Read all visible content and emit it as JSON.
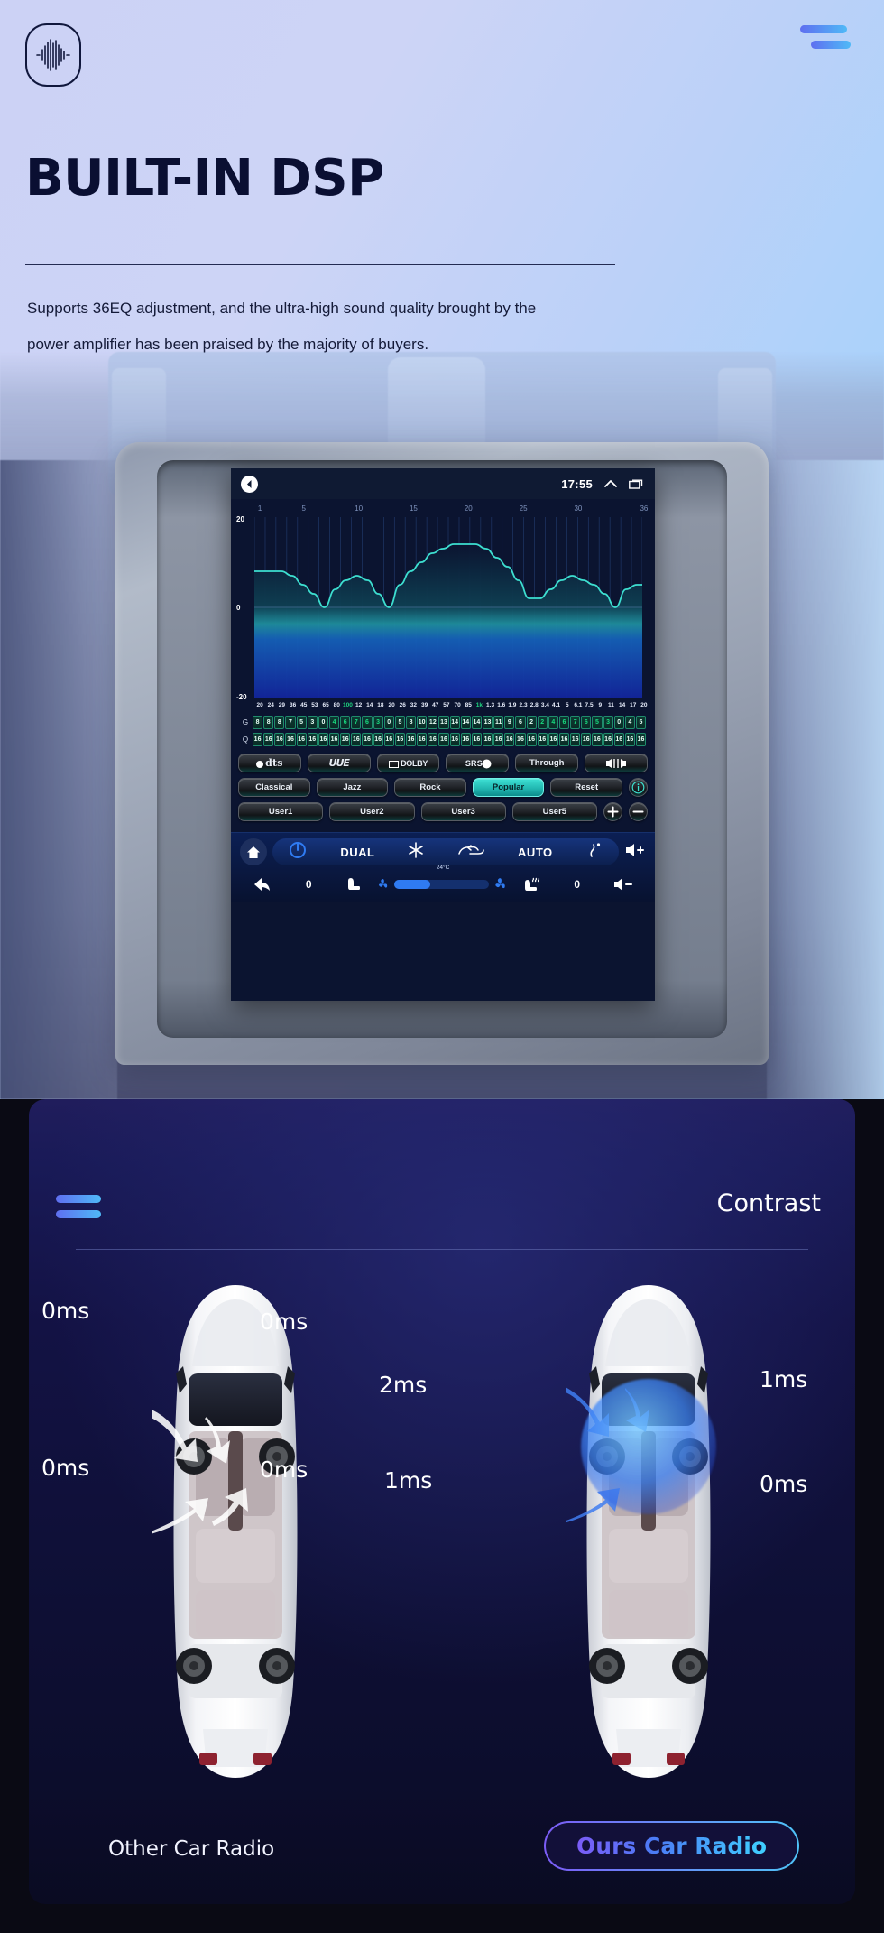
{
  "hero": {
    "logo_icon": "audio-waveform-icon",
    "menu_icon": "hamburger-icon",
    "title": "BUILT-IN DSP",
    "subtitle": "Supports 36EQ adjustment, and the ultra-high sound quality brought by the power amplifier has been praised by the majority of buyers."
  },
  "head_unit": {
    "status_bar": {
      "back_icon": "back-arrow-icon",
      "time": "17:55",
      "chevron_icon": "chevron-up-icon",
      "recents_icon": "recents-icon"
    },
    "eq": {
      "x_ticks": [
        "1",
        "5",
        "10",
        "15",
        "20",
        "25",
        "30",
        "36"
      ],
      "y_labels": {
        "top": "20",
        "mid": "0",
        "bottom": "-20"
      },
      "gain_row_label": "G",
      "q_row_label": "Q",
      "frequencies": [
        "20",
        "24",
        "29",
        "36",
        "45",
        "53",
        "65",
        "80",
        "100",
        "12",
        "14",
        "18",
        "20",
        "26",
        "32",
        "39",
        "47",
        "57",
        "70",
        "85",
        "1k",
        "1.3",
        "1.6",
        "1.9",
        "2.3",
        "2.8",
        "3.4",
        "4.1",
        "5",
        "6.1",
        "7.5",
        "9",
        "11",
        "14",
        "17",
        "20"
      ],
      "gains": [
        8,
        8,
        8,
        7,
        5,
        3,
        0,
        4,
        6,
        7,
        6,
        3,
        0,
        5,
        8,
        10,
        12,
        13,
        14,
        14,
        14,
        13,
        11,
        9,
        6,
        2,
        2,
        4,
        6,
        7,
        6,
        5,
        3,
        0,
        4,
        5
      ],
      "q_values": [
        16,
        16,
        16,
        16,
        16,
        16,
        16,
        16,
        16,
        16,
        16,
        16,
        16,
        16,
        16,
        16,
        16,
        16,
        16,
        16,
        16,
        16,
        16,
        16,
        16,
        16,
        16,
        16,
        16,
        16,
        16,
        16,
        16,
        16,
        16,
        16
      ],
      "highlight_freq_indices": [
        8,
        20
      ],
      "highlight_gain_indices": [
        7,
        8,
        9,
        10,
        11,
        26,
        27,
        28,
        29,
        30,
        31,
        32
      ]
    },
    "presets": {
      "row1": [
        {
          "label": "dts",
          "kind": "logo-dts",
          "active": false
        },
        {
          "label": "UUE",
          "kind": "logo-uue",
          "active": false
        },
        {
          "label": "DOLBY",
          "kind": "logo-dolby",
          "active": false
        },
        {
          "label": "SRS",
          "kind": "logo-srs",
          "active": false
        },
        {
          "label": "Through",
          "kind": "text",
          "active": false
        },
        {
          "label": "",
          "kind": "balance-icon",
          "active": false
        }
      ],
      "row2": [
        {
          "label": "Classical",
          "kind": "text",
          "active": false
        },
        {
          "label": "Jazz",
          "kind": "text",
          "active": false
        },
        {
          "label": "Rock",
          "kind": "text",
          "active": false
        },
        {
          "label": "Popular",
          "kind": "text",
          "active": true
        },
        {
          "label": "Reset",
          "kind": "text",
          "active": false
        },
        {
          "label": "i",
          "kind": "info-icon",
          "active": false
        }
      ],
      "row3": [
        {
          "label": "User1",
          "kind": "text",
          "active": false
        },
        {
          "label": "User2",
          "kind": "text",
          "active": false
        },
        {
          "label": "User3",
          "kind": "text",
          "active": false
        },
        {
          "label": "User5",
          "kind": "text",
          "active": false
        },
        {
          "label": "+",
          "kind": "plus-icon",
          "active": false
        },
        {
          "label": "−",
          "kind": "minus-icon",
          "active": false
        }
      ]
    },
    "climate": {
      "home_icon": "home-icon",
      "power_icon": "power-icon",
      "dual_label": "DUAL",
      "ac_icon": "snowflake-icon",
      "recirculate_icon": "air-recirculation-icon",
      "auto_label": "AUTO",
      "defrost_icon": "defrost-icon",
      "volume_up_icon": "volume-up-icon",
      "temperature": "24°C",
      "back_icon": "back-arrow-icon",
      "left_value": "0",
      "seat_icon": "seat-airflow-icon",
      "fan_low_icon": "fan-low-icon",
      "fan_high_icon": "fan-high-icon",
      "fan_level_percent": 38,
      "seat_heat_icon": "seat-heat-icon",
      "right_value": "0",
      "volume_down_icon": "volume-down-icon"
    }
  },
  "contrast": {
    "menu_icon": "hamburger-icon",
    "title": "Contrast",
    "left_car": {
      "caption": "Other Car Radio",
      "labels": {
        "front_left": "0ms",
        "front_right": "0ms",
        "rear_left": "0ms",
        "rear_right": "0ms"
      }
    },
    "right_car": {
      "caption": "Ours Car Radio",
      "labels": {
        "front_left": "2ms",
        "front_right": "1ms",
        "rear_left": "1ms",
        "rear_right": "0ms"
      }
    }
  },
  "colors": {
    "accent_blue": "#4fb9f7",
    "accent_violet": "#7b5cf6",
    "eq_curve": "#3ddfd0",
    "preset_active": "#22b9b2",
    "panel_bg": "#131244"
  }
}
